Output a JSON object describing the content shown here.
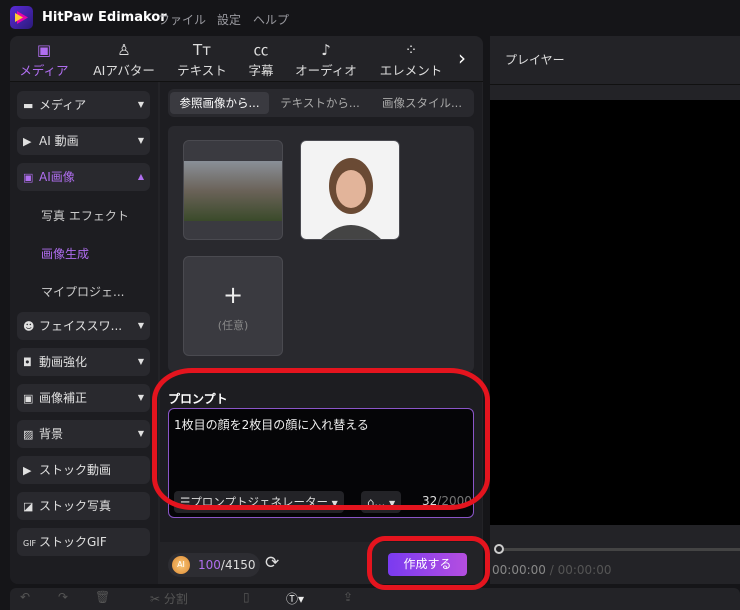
{
  "app": {
    "title": "HitPaw Edimakor",
    "menu": [
      "ファイル",
      "設定",
      "ヘルプ"
    ]
  },
  "tabs": [
    {
      "label": "メディア",
      "icon": "image-icon"
    },
    {
      "label": "AIアバター",
      "icon": "avatar-icon"
    },
    {
      "label": "テキスト",
      "icon": "text-icon"
    },
    {
      "label": "字幕",
      "icon": "cc-icon"
    },
    {
      "label": "オーディオ",
      "icon": "music-icon"
    },
    {
      "label": "エレメント",
      "icon": "elements-icon"
    }
  ],
  "sidebar": {
    "items": [
      {
        "label": "メディア"
      },
      {
        "label": "AI 動画"
      },
      {
        "label": "AI画像"
      },
      {
        "label": "フェイススワ..."
      },
      {
        "label": "動画強化"
      },
      {
        "label": "画像補正"
      },
      {
        "label": "背景"
      },
      {
        "label": "ストック動画"
      },
      {
        "label": "ストック写真"
      },
      {
        "label": "ストックGIF"
      }
    ],
    "sub": [
      "写真 エフェクト",
      "画像生成",
      "マイプロジェ..."
    ]
  },
  "segments": [
    "参照画像から...",
    "テキストから...",
    "画像スタイル..."
  ],
  "gallery": {
    "add_label": "(任意)"
  },
  "prompt": {
    "label": "プロンプト",
    "text": "1枚目の顔を2枚目の顔に入れ替える",
    "generator": "プロンプトジェネレーター",
    "tag": "...",
    "count": "32",
    "max": "/2000"
  },
  "credits": {
    "coin": "AI",
    "used": "100",
    "total": "/4150"
  },
  "generate_label": "作成する",
  "player": {
    "title": "プレイヤー",
    "time": "00:00:00",
    "duration": "/ 00:00:00"
  },
  "toolbar": {
    "split": "分割"
  }
}
